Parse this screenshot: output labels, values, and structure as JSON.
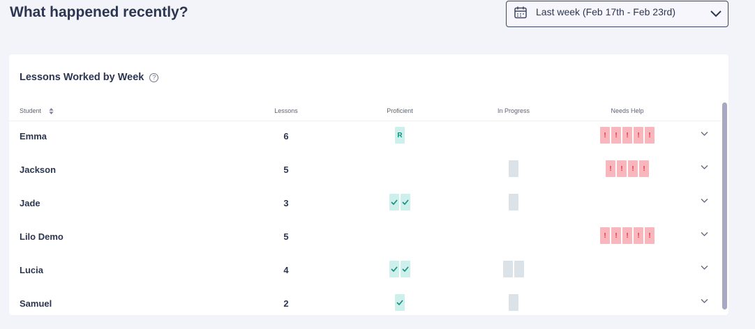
{
  "header": {
    "title": "What happened recently?",
    "date_range": "Last week (Feb 17th - Feb 23rd)"
  },
  "card": {
    "title": "Lessons Worked by Week",
    "columns": {
      "student": "Student",
      "lessons": "Lessons",
      "proficient": "Proficient",
      "in_progress": "In Progress",
      "needs_help": "Needs Help"
    }
  },
  "rows": [
    {
      "student": "Emma",
      "lessons": "6",
      "proficient": [
        "R"
      ],
      "in_progress": 0,
      "needs_help": 5
    },
    {
      "student": "Jackson",
      "lessons": "5",
      "proficient": [],
      "in_progress": 1,
      "needs_help": 4
    },
    {
      "student": "Jade",
      "lessons": "3",
      "proficient": [
        "✓",
        "✓"
      ],
      "in_progress": 1,
      "needs_help": 0
    },
    {
      "student": "Lilo Demo",
      "lessons": "5",
      "proficient": [],
      "in_progress": 0,
      "needs_help": 5
    },
    {
      "student": "Lucia",
      "lessons": "4",
      "proficient": [
        "✓",
        "✓"
      ],
      "in_progress": 2,
      "needs_help": 0
    },
    {
      "student": "Samuel",
      "lessons": "2",
      "proficient": [
        "✓"
      ],
      "in_progress": 1,
      "needs_help": 0
    }
  ],
  "colors": {
    "proficient_bg": "#cdf0ec",
    "proficient_fg": "#1a8c7c",
    "in_progress_bg": "#dbe2e8",
    "needs_help_bg": "#f7b7bd",
    "needs_help_fg": "#e0374a"
  },
  "icons": {
    "date_picker": "calendar-icon",
    "dropdown": "chevron-down-icon",
    "help": "help-circle-icon",
    "sort": "sort-icon",
    "proficient_mark": "check-icon",
    "needs_help_mark": "exclamation-icon",
    "row_expand": "chevron-down-icon"
  }
}
